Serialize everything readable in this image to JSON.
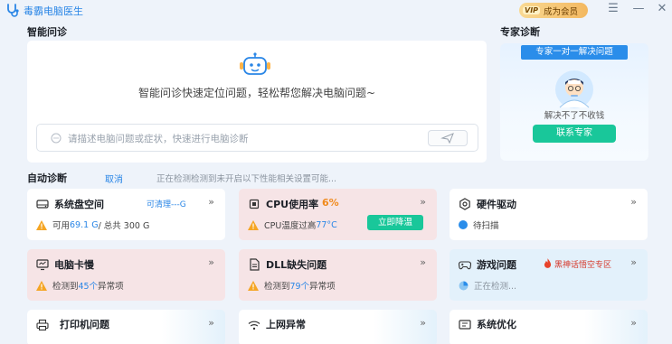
{
  "app": {
    "title": "毒霸电脑医生"
  },
  "vip": {
    "badge": "VIP",
    "label": "成为会员"
  },
  "window": {
    "menu_glyph": "☰",
    "minimize_glyph": "—",
    "close_glyph": "✕"
  },
  "ai": {
    "title": "智能问诊",
    "description": "智能问诊快速定位问题，轻松帮您解决电脑问题~",
    "placeholder": "请描述电脑问题或症状，快速进行电脑诊断"
  },
  "expert": {
    "title": "专家诊断",
    "ribbon": "专家一对一解决问题",
    "subtitle": "解决不了不收钱",
    "button": "联系专家"
  },
  "auto": {
    "title": "自动诊断",
    "cancel": "取消",
    "status": "正在检测检测到未开启以下性能相关设置可能..."
  },
  "tiles": {
    "disk": {
      "name": "系统盘空间",
      "tag": "可清理---G",
      "arrow": "»",
      "prefix": "可用 ",
      "value": "69.1 G",
      "suffix": " / 总共 300 G"
    },
    "cpu": {
      "name": "CPU使用率",
      "percent": "6%",
      "arrow": "»",
      "prefix": "CPU温度过高 ",
      "temp": "77°C",
      "button": "立即降温"
    },
    "hardware": {
      "name": "硬件驱动",
      "arrow": "»",
      "status": "待扫描"
    },
    "lag": {
      "name": "电脑卡慢",
      "arrow": "»",
      "prefix": "检测到 ",
      "count": "45个",
      "suffix": " 异常项"
    },
    "dll": {
      "name": "DLL缺失问题",
      "arrow": "»",
      "prefix": "检测到 ",
      "count": "79个",
      "suffix": " 异常项"
    },
    "game": {
      "name": "游戏问题",
      "tag": "黑神话悟空专区",
      "arrow": "»",
      "status": "正在检测..."
    },
    "printer": {
      "name": "打印机问题",
      "arrow": "»"
    },
    "network": {
      "name": "上网异常",
      "arrow": "»"
    },
    "optimize": {
      "name": "系统优化",
      "arrow": "»"
    }
  },
  "colors": {
    "accent": "#2a86e6",
    "green": "#19c79a",
    "orange": "#f08a1d",
    "pink_tile": "#f6e4e6",
    "blue_tile": "#e3f1fb"
  },
  "icons": [
    "stethoscope-icon",
    "robot-icon",
    "chat-icon",
    "send-icon",
    "doctor-avatar",
    "disk-icon",
    "cpu-icon",
    "hardware-icon",
    "monitor-icon",
    "dll-icon",
    "gamepad-icon",
    "printer-icon",
    "wifi-icon",
    "optimize-icon",
    "warning-icon",
    "fire-icon"
  ]
}
